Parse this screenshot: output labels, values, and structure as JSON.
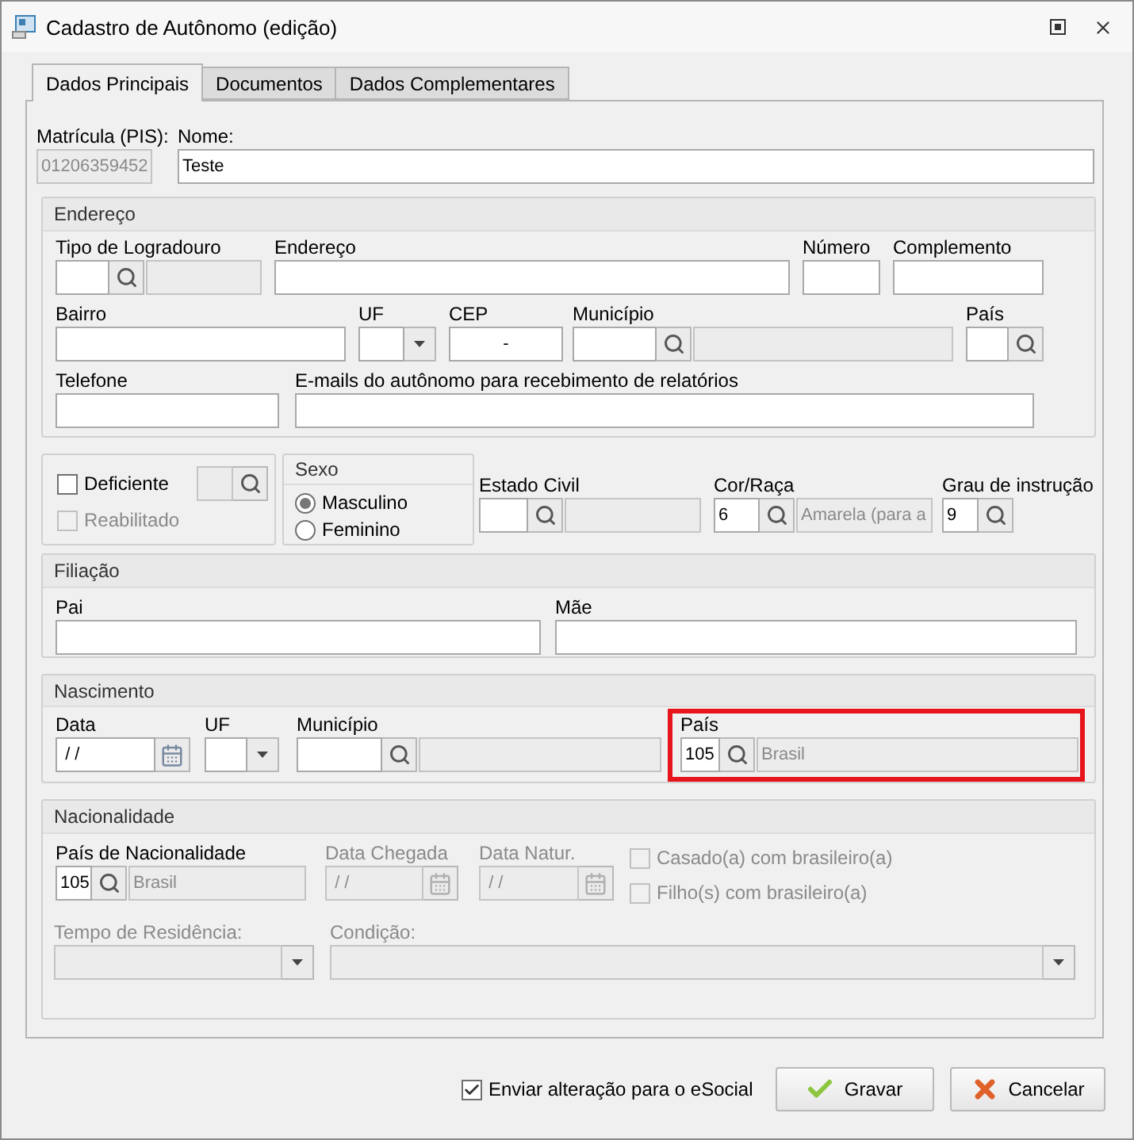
{
  "window": {
    "title": "Cadastro de Autônomo (edição)"
  },
  "tabs": [
    {
      "label": "Dados Principais",
      "selected": true
    },
    {
      "label": "Documentos",
      "selected": false
    },
    {
      "label": "Dados Complementares",
      "selected": false
    }
  ],
  "main": {
    "matricula": {
      "label": "Matrícula (PIS):",
      "value": "01206359452",
      "readonly": true
    },
    "nome": {
      "label": "Nome:",
      "value": "Teste"
    }
  },
  "endereco": {
    "title": "Endereço",
    "tipo_logradouro": {
      "label": "Tipo de Logradouro"
    },
    "endereco": {
      "label": "Endereço"
    },
    "numero": {
      "label": "Número"
    },
    "complemento": {
      "label": "Complemento"
    },
    "bairro": {
      "label": "Bairro"
    },
    "uf": {
      "label": "UF"
    },
    "cep": {
      "label": "CEP",
      "value": "-"
    },
    "municipio": {
      "label": "Município"
    },
    "pais": {
      "label": "País"
    },
    "telefone": {
      "label": "Telefone"
    },
    "emails": {
      "label": "E-mails do autônomo para recebimento de relatórios"
    }
  },
  "deficiencia": {
    "deficiente": {
      "label": "Deficiente",
      "checked": false,
      "disabled": false
    },
    "codigo": {
      "disabled": true
    },
    "reabilitado": {
      "label": "Reabilitado",
      "checked": false,
      "disabled": true
    }
  },
  "sexo": {
    "title": "Sexo",
    "options": [
      {
        "label": "Masculino",
        "selected": true
      },
      {
        "label": "Feminino",
        "selected": false
      }
    ]
  },
  "estado_civil": {
    "label": "Estado Civil"
  },
  "cor_raca": {
    "label": "Cor/Raça",
    "value": "6",
    "description": "Amarela (para a"
  },
  "grau_instrucao": {
    "label": "Grau de instrução",
    "value": "9"
  },
  "filiacao": {
    "title": "Filiação",
    "pai": {
      "label": "Pai"
    },
    "mae": {
      "label": "Mãe"
    }
  },
  "nascimento": {
    "title": "Nascimento",
    "data": {
      "label": "Data",
      "value": "/ /"
    },
    "uf": {
      "label": "UF"
    },
    "municipio": {
      "label": "Município"
    },
    "pais": {
      "label": "País",
      "value": "105",
      "description": "Brasil",
      "highlighted": true
    }
  },
  "nacionalidade": {
    "title": "Nacionalidade",
    "pais": {
      "label": "País de Nacionalidade",
      "value": "105",
      "description": "Brasil"
    },
    "data_chegada": {
      "label": "Data Chegada",
      "value": "/ /",
      "disabled": true
    },
    "data_natur": {
      "label": "Data Natur.",
      "value": "/ /",
      "disabled": true
    },
    "casado": {
      "label": "Casado(a) com brasileiro(a)",
      "checked": false,
      "disabled": true
    },
    "filho": {
      "label": "Filho(s) com brasileiro(a)",
      "checked": false,
      "disabled": true
    },
    "tempo_residencia": {
      "label": "Tempo de Residência:",
      "disabled": true
    },
    "condicao": {
      "label": "Condição:",
      "disabled": true
    }
  },
  "footer": {
    "enviar": {
      "label": "Enviar alteração para o eSocial",
      "checked": true
    },
    "buttons": [
      {
        "kind": "save",
        "label": "Gravar"
      },
      {
        "kind": "cancel",
        "label": "Cancelar"
      }
    ]
  }
}
